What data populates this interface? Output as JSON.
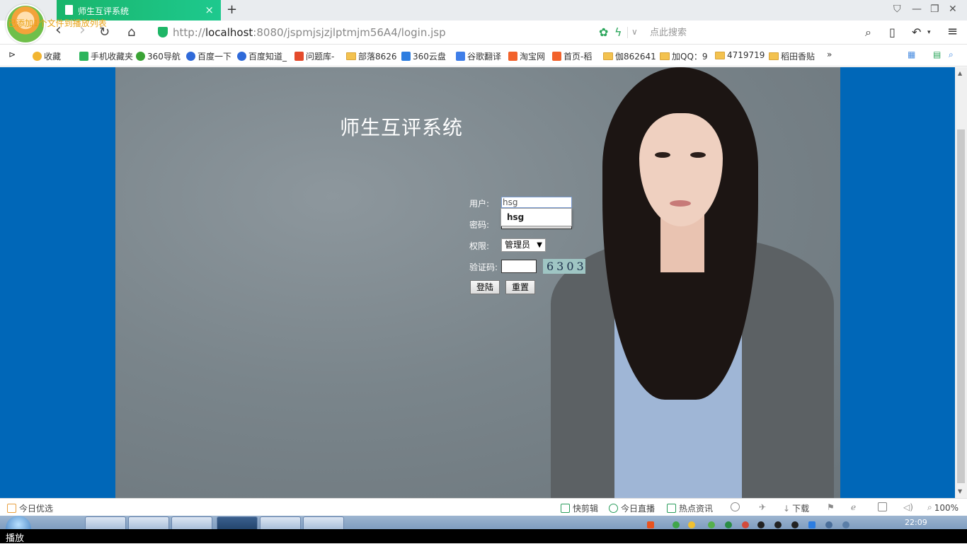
{
  "tab": {
    "title": "师生互评系统",
    "close": "×",
    "new": "+"
  },
  "avatar_note": "已添加1个文件到播放列表",
  "window": {
    "skin": "⛉",
    "min": "—",
    "max": "❐",
    "close": "✕"
  },
  "nav": {
    "back": "‹",
    "forward": "›",
    "reload": "↻",
    "home": "⌂"
  },
  "address": {
    "scheme": "http://",
    "host": "localhost",
    "rest": ":8080/jspmjsjzjlptmjm56A4/login.jsp"
  },
  "search": {
    "placeholder": "点此搜索"
  },
  "bookmarks": [
    {
      "label": "收藏",
      "icon": "star-icon",
      "color": "#f2b531"
    },
    {
      "label": "手机收藏夹",
      "icon": "phone-icon",
      "color": "#2db55d"
    },
    {
      "label": "360导航",
      "icon": "360-icon",
      "color": "#3aa335"
    },
    {
      "label": "百度一下",
      "icon": "baidu-icon",
      "color": "#2f6ad9"
    },
    {
      "label": "百度知道_",
      "icon": "baidu-icon",
      "color": "#2f6ad9"
    },
    {
      "label": "问题库-",
      "icon": "s-icon",
      "color": "#e44b2c"
    },
    {
      "label": "部落8626",
      "icon": "folder-icon",
      "color": "#f3c24f"
    },
    {
      "label": "360云盘",
      "icon": "cloud-icon",
      "color": "#2d7de0"
    },
    {
      "label": "谷歌翻译",
      "icon": "translate-icon",
      "color": "#3f7ee8"
    },
    {
      "label": "淘宝网",
      "icon": "taobao-icon",
      "color": "#f2622b"
    },
    {
      "label": "首页-稻",
      "icon": "taobao-icon",
      "color": "#f2622b"
    },
    {
      "label": "伽862641",
      "icon": "folder-icon",
      "color": "#f3c24f"
    },
    {
      "label": "加QQ：9",
      "icon": "folder-icon",
      "color": "#f3c24f"
    },
    {
      "label": "4719719",
      "icon": "folder-icon",
      "color": "#f3c24f"
    },
    {
      "label": "稻田香贴",
      "icon": "folder-icon",
      "color": "#f3c24f"
    }
  ],
  "bookmarks_more": "»",
  "login": {
    "title": "师生互评系统",
    "user_label": "用户:",
    "user_value": "hsg",
    "autocomplete": "hsg",
    "pwd_label": "密码:",
    "role_label": "权限:",
    "role_value": "管理员",
    "captcha_label": "验证码:",
    "captcha_code": "6303",
    "login_button": "登陆",
    "reset_button": "重置"
  },
  "status": {
    "left": "今日优选",
    "video_edit": "快剪辑",
    "live": "今日直播",
    "news": "热点资讯",
    "download": "下载",
    "zoom": "100%"
  },
  "taskbar": {
    "clock": "22:09"
  },
  "bottom_strip": "播放"
}
